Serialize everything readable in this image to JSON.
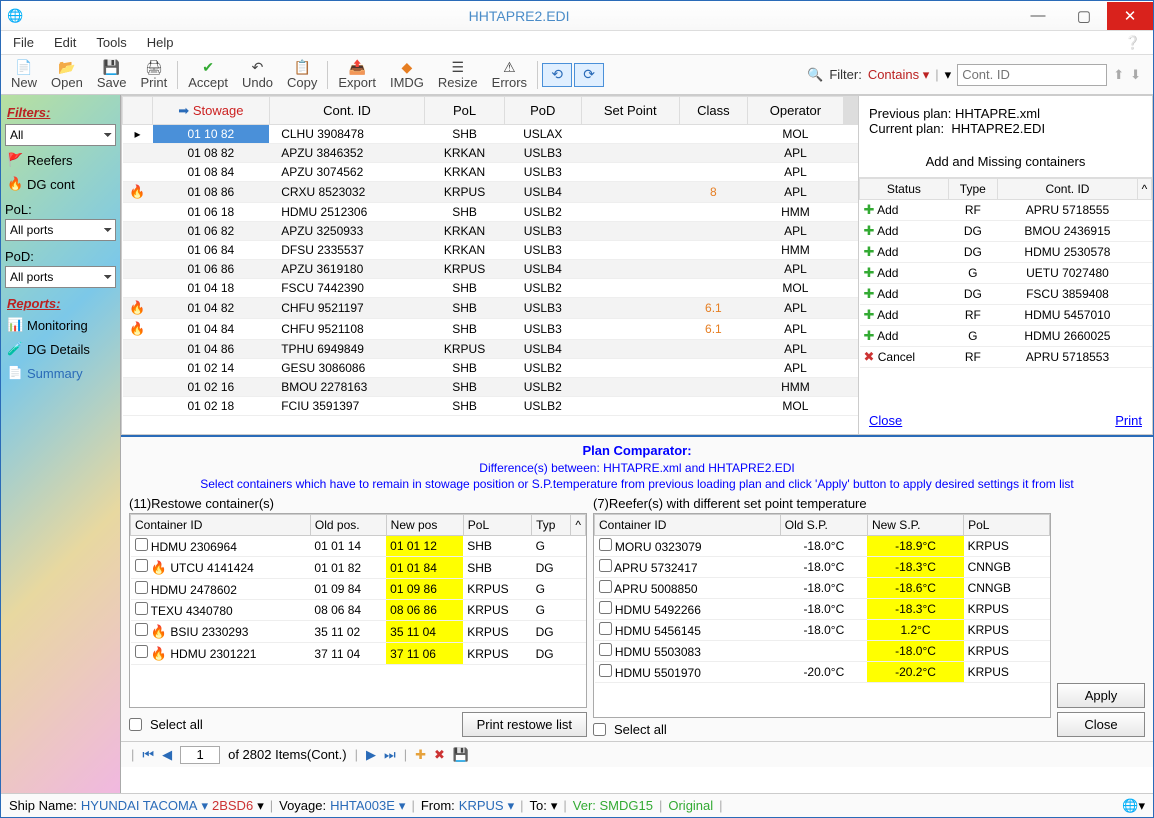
{
  "window": {
    "title": "HHTAPRE2.EDI"
  },
  "menu": {
    "file": "File",
    "edit": "Edit",
    "tools": "Tools",
    "help": "Help"
  },
  "toolbar": {
    "new": "New",
    "open": "Open",
    "save": "Save",
    "print": "Print",
    "accept": "Accept",
    "undo": "Undo",
    "copy": "Copy",
    "export": "Export",
    "imdg": "IMDG",
    "resize": "Resize",
    "errors": "Errors"
  },
  "filter": {
    "label": "Filter:",
    "mode": "Contains",
    "placeholder": "Cont. ID"
  },
  "sidebar": {
    "filters_hdr": "Filters:",
    "all": "All",
    "reefers": "Reefers",
    "dgcont": "DG cont",
    "pol_hdr": "PoL:",
    "pol_value": "All ports",
    "pod_hdr": "PoD:",
    "pod_value": "All ports",
    "reports_hdr": "Reports:",
    "monitoring": "Monitoring",
    "dgdetails": "DG Details",
    "summary": "Summary"
  },
  "grid": {
    "headers": {
      "stowage": "Stowage",
      "contid": "Cont. ID",
      "pol": "PoL",
      "pod": "PoD",
      "setpoint": "Set Point",
      "class": "Class",
      "operator": "Operator"
    },
    "rows": [
      {
        "flame": false,
        "stow": "01 10 82",
        "cont": "CLHU 3908478",
        "pol": "SHB",
        "pod": "USLAX",
        "sp": "",
        "cls": "",
        "op": "MOL",
        "sel": true
      },
      {
        "flame": false,
        "stow": "01 08 82",
        "cont": "APZU 3846352",
        "pol": "KRKAN",
        "pod": "USLB3",
        "sp": "",
        "cls": "",
        "op": "APL"
      },
      {
        "flame": false,
        "stow": "01 08 84",
        "cont": "APZU 3074562",
        "pol": "KRKAN",
        "pod": "USLB3",
        "sp": "",
        "cls": "",
        "op": "APL"
      },
      {
        "flame": true,
        "stow": "01 08 86",
        "cont": "CRXU 8523032",
        "pol": "KRPUS",
        "pod": "USLB4",
        "sp": "",
        "cls": "8",
        "op": "APL"
      },
      {
        "flame": false,
        "stow": "01 06 18",
        "cont": "HDMU 2512306",
        "pol": "SHB",
        "pod": "USLB2",
        "sp": "",
        "cls": "",
        "op": "HMM"
      },
      {
        "flame": false,
        "stow": "01 06 82",
        "cont": "APZU 3250933",
        "pol": "KRKAN",
        "pod": "USLB3",
        "sp": "",
        "cls": "",
        "op": "APL"
      },
      {
        "flame": false,
        "stow": "01 06 84",
        "cont": "DFSU 2335537",
        "pol": "KRKAN",
        "pod": "USLB3",
        "sp": "",
        "cls": "",
        "op": "HMM"
      },
      {
        "flame": false,
        "stow": "01 06 86",
        "cont": "APZU 3619180",
        "pol": "KRPUS",
        "pod": "USLB4",
        "sp": "",
        "cls": "",
        "op": "APL"
      },
      {
        "flame": false,
        "stow": "01 04 18",
        "cont": "FSCU 7442390",
        "pol": "SHB",
        "pod": "USLB2",
        "sp": "",
        "cls": "",
        "op": "MOL"
      },
      {
        "flame": true,
        "stow": "01 04 82",
        "cont": "CHFU 9521197",
        "pol": "SHB",
        "pod": "USLB3",
        "sp": "",
        "cls": "6.1",
        "op": "APL"
      },
      {
        "flame": true,
        "stow": "01 04 84",
        "cont": "CHFU 9521108",
        "pol": "SHB",
        "pod": "USLB3",
        "sp": "",
        "cls": "6.1",
        "op": "APL"
      },
      {
        "flame": false,
        "stow": "01 04 86",
        "cont": "TPHU 6949849",
        "pol": "KRPUS",
        "pod": "USLB4",
        "sp": "",
        "cls": "",
        "op": "APL"
      },
      {
        "flame": false,
        "stow": "01 02 14",
        "cont": "GESU 3086086",
        "pol": "SHB",
        "pod": "USLB2",
        "sp": "",
        "cls": "",
        "op": "APL"
      },
      {
        "flame": false,
        "stow": "01 02 16",
        "cont": "BMOU 2278163",
        "pol": "SHB",
        "pod": "USLB2",
        "sp": "",
        "cls": "",
        "op": "HMM"
      },
      {
        "flame": false,
        "stow": "01 02 18",
        "cont": "FCIU 3591397",
        "pol": "SHB",
        "pod": "USLB2",
        "sp": "",
        "cls": "",
        "op": "MOL"
      }
    ]
  },
  "right": {
    "prev_label": "Previous plan:",
    "prev": "HHTAPRE.xml",
    "curr_label": "Current plan:",
    "curr": "HHTAPRE2.EDI",
    "hdr2": "Add and Missing containers",
    "cols": {
      "status": "Status",
      "type": "Type",
      "contid": "Cont. ID"
    },
    "rows": [
      {
        "act": "add",
        "status": "Add",
        "type": "RF",
        "cont": "APRU 5718555"
      },
      {
        "act": "add",
        "status": "Add",
        "type": "DG",
        "cont": "BMOU 2436915"
      },
      {
        "act": "add",
        "status": "Add",
        "type": "DG",
        "cont": "HDMU 2530578"
      },
      {
        "act": "add",
        "status": "Add",
        "type": "G",
        "cont": "UETU 7027480"
      },
      {
        "act": "add",
        "status": "Add",
        "type": "DG",
        "cont": "FSCU 3859408"
      },
      {
        "act": "add",
        "status": "Add",
        "type": "RF",
        "cont": "HDMU 5457010"
      },
      {
        "act": "add",
        "status": "Add",
        "type": "G",
        "cont": "HDMU 2660025"
      },
      {
        "act": "cancel",
        "status": "Cancel",
        "type": "RF",
        "cont": "APRU 5718553"
      }
    ],
    "close": "Close",
    "print": "Print"
  },
  "comparator": {
    "title": "Plan Comparator:",
    "sub1": "Difference(s) between: HHTAPRE.xml and HHTAPRE2.EDI",
    "sub2": "Select containers which have to remain in stowage position or S.P.temperature from previous loading plan and click 'Apply' button to apply desired settings it from list",
    "restowe_label": "(11)Restowe container(s)",
    "reefer_label": "(7)Reefer(s) with different  set point temperature",
    "restowe_cols": {
      "cid": "Container ID",
      "old": "Old pos.",
      "new": "New pos",
      "pol": "PoL",
      "typ": "Typ"
    },
    "restowe_rows": [
      {
        "flame": false,
        "cid": "HDMU 2306964",
        "old": "01 01 14",
        "new": "01 01 12",
        "pol": "SHB",
        "typ": "G"
      },
      {
        "flame": true,
        "cid": "UTCU 4141424",
        "old": "01 01 82",
        "new": "01 01 84",
        "pol": "SHB",
        "typ": "DG"
      },
      {
        "flame": false,
        "cid": "HDMU 2478602",
        "old": "01 09 84",
        "new": "01 09 86",
        "pol": "KRPUS",
        "typ": "G"
      },
      {
        "flame": false,
        "cid": "TEXU 4340780",
        "old": "08 06 84",
        "new": "08 06 86",
        "pol": "KRPUS",
        "typ": "G"
      },
      {
        "flame": true,
        "cid": "BSIU 2330293",
        "old": "35 11 02",
        "new": "35 11 04",
        "pol": "KRPUS",
        "typ": "DG"
      },
      {
        "flame": true,
        "cid": "HDMU 2301221",
        "old": "37 11 04",
        "new": "37 11 06",
        "pol": "KRPUS",
        "typ": "DG"
      }
    ],
    "reefer_cols": {
      "cid": "Container ID",
      "old": "Old S.P.",
      "new": "New S.P.",
      "pol": "PoL"
    },
    "reefer_rows": [
      {
        "cid": "MORU 0323079",
        "old": "-18.0°C",
        "new": "-18.9°C",
        "pol": "KRPUS"
      },
      {
        "cid": "APRU 5732417",
        "old": "-18.0°C",
        "new": "-18.3°C",
        "pol": "CNNGB"
      },
      {
        "cid": "APRU 5008850",
        "old": "-18.0°C",
        "new": "-18.6°C",
        "pol": "CNNGB"
      },
      {
        "cid": "HDMU 5492266",
        "old": "-18.0°C",
        "new": "-18.3°C",
        "pol": "KRPUS"
      },
      {
        "cid": "HDMU 5456145",
        "old": "-18.0°C",
        "new": "1.2°C",
        "pol": "KRPUS"
      },
      {
        "cid": "HDMU 5503083",
        "old": "",
        "new": "-18.0°C",
        "pol": "KRPUS"
      },
      {
        "cid": "HDMU 5501970",
        "old": "-20.0°C",
        "new": "-20.2°C",
        "pol": "KRPUS"
      }
    ],
    "select_all": "Select all",
    "print_restowe": "Print restowe list",
    "apply": "Apply",
    "close_btn": "Close"
  },
  "pager": {
    "page": "1",
    "of": "of 2802 Items(Cont.)"
  },
  "status": {
    "ship_lbl": "Ship Name:",
    "ship": "HYUNDAI TACOMA",
    "code": "2BSD6",
    "voy_lbl": "Voyage:",
    "voy": "HHTA003E",
    "from_lbl": "From:",
    "from": "KRPUS",
    "to_lbl": "To:",
    "ver": "Ver: SMDG15",
    "orig": "Original"
  }
}
